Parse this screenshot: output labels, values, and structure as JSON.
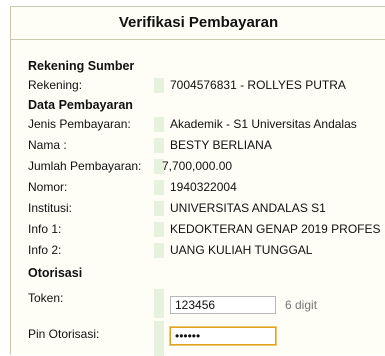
{
  "title": "Verifikasi Pembayaran",
  "sections": {
    "source": "Rekening Sumber",
    "payment": "Data Pembayaran",
    "auth": "Otorisasi"
  },
  "source_rows": [
    {
      "label": "Rekening:",
      "value": "7004576831 - ROLLYES PUTRA"
    }
  ],
  "payment_rows": [
    {
      "label": "Jenis Pembayaran:",
      "value": "Akademik - S1 Universitas Andalas"
    },
    {
      "label": "Nama :",
      "value": "BESTY BERLIANA"
    },
    {
      "label": "Jumlah Pembayaran:",
      "value": "7,700,000.00"
    },
    {
      "label": "Nomor:",
      "value": "1940322004"
    },
    {
      "label": "Institusi:",
      "value": "UNIVERSITAS ANDALAS S1"
    },
    {
      "label": "Info 1:",
      "value": "KEDOKTERAN GENAP 2019 PROFES"
    },
    {
      "label": "Info 2:",
      "value": "UANG KULIAH TUNGGAL"
    }
  ],
  "auth": {
    "token_label": "Token:",
    "token_value": "123456",
    "token_hint": "6 digit",
    "pin_label": "Pin Otorisasi:",
    "pin_value": "••••••"
  },
  "colors": {
    "panel_bg": "#fefdf6",
    "gutter": "#e6f2dd",
    "focus_border": "#e0a020"
  }
}
